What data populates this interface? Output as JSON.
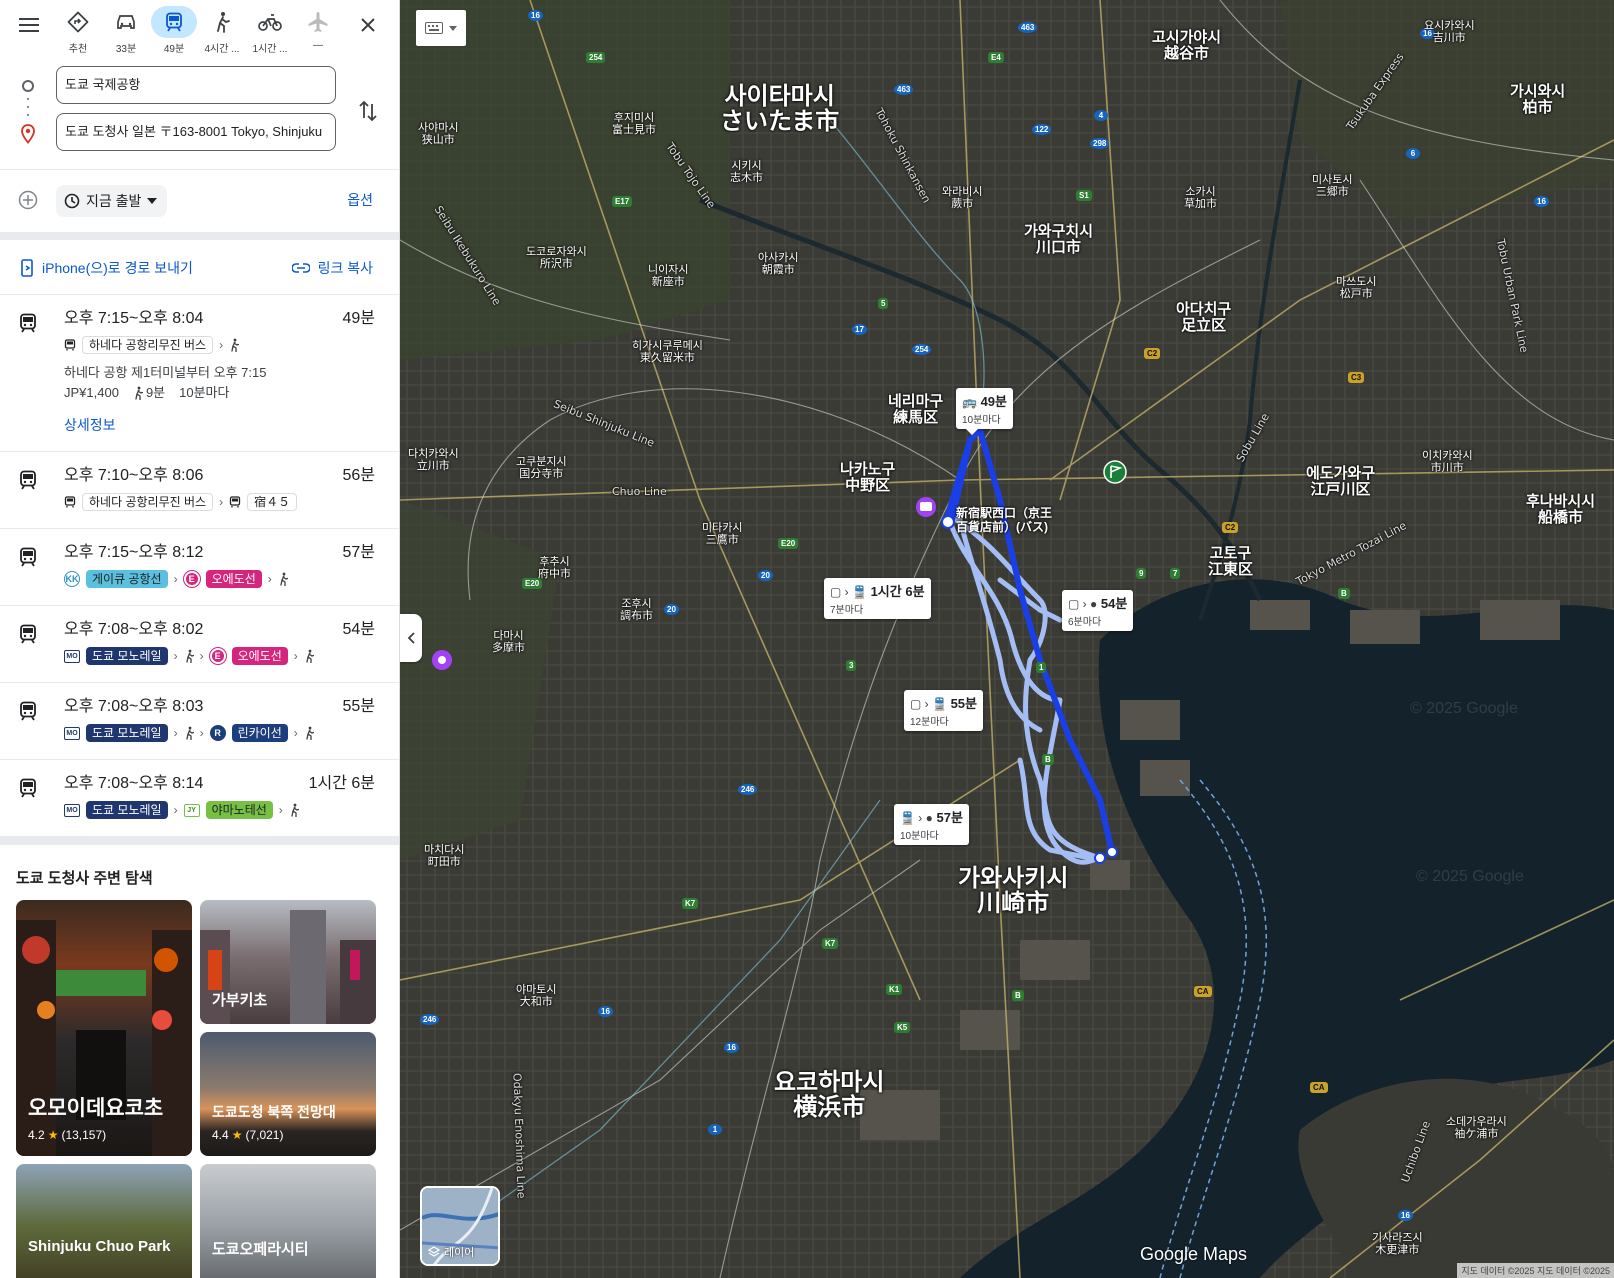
{
  "modes": [
    {
      "label": "추천",
      "icon": "directions-icon",
      "active": false
    },
    {
      "label": "33분",
      "icon": "car-icon",
      "active": false
    },
    {
      "label": "49분",
      "icon": "transit-icon",
      "active": true
    },
    {
      "label": "4시간 ...",
      "icon": "walk-icon",
      "active": false
    },
    {
      "label": "1시간 ...",
      "icon": "bike-icon",
      "active": false
    },
    {
      "label": "—",
      "icon": "flight-icon",
      "active": false
    }
  ],
  "inputs": {
    "origin": "도쿄 국제공항",
    "destination": "도쿄 도청사 일본 〒163-8001 Tokyo, Shinjuku"
  },
  "depart": {
    "label": "지금 출발",
    "options_label": "옵션"
  },
  "share": {
    "send_label": "iPhone(으)로 경로 보내기",
    "copy_label": "링크 복사"
  },
  "routes": [
    {
      "time": "오후 7:15~오후 8:04",
      "duration": "49분",
      "steps": [
        {
          "type": "bus-chip",
          "text": "하네다 공항리무진 버스"
        },
        {
          "type": "walk"
        }
      ],
      "sub1": "하네다 공항 제1터미널부터 오후 7:15",
      "fare": "JP¥1,400",
      "walk": "9분",
      "freq": "10분마다",
      "details": "상세정보"
    },
    {
      "time": "오후 7:10~오후 8:06",
      "duration": "56분",
      "steps": [
        {
          "type": "bus-chip",
          "text": "하네다 공항리무진 버스"
        },
        {
          "type": "bus-chip2",
          "text": "宿４５"
        }
      ]
    },
    {
      "time": "오후 7:15~오후 8:12",
      "duration": "57분",
      "steps": [
        {
          "type": "kk",
          "circle": "KK",
          "text": "게이큐 공항선"
        },
        {
          "type": "e",
          "circle": "E",
          "text": "오에도선"
        },
        {
          "type": "walk"
        }
      ]
    },
    {
      "time": "오후 7:08~오후 8:02",
      "duration": "54분",
      "steps": [
        {
          "type": "mono",
          "square": "MO",
          "text": "도쿄 모노레일"
        },
        {
          "type": "walk"
        },
        {
          "type": "e",
          "circle": "E",
          "text": "오에도선"
        },
        {
          "type": "walk"
        }
      ]
    },
    {
      "time": "오후 7:08~오후 8:03",
      "duration": "55분",
      "steps": [
        {
          "type": "mono",
          "square": "MO",
          "text": "도쿄 모노레일"
        },
        {
          "type": "walk"
        },
        {
          "type": "r",
          "circle": "R",
          "text": "린카이선"
        },
        {
          "type": "walk"
        }
      ]
    },
    {
      "time": "오후 7:08~오후 8:14",
      "duration": "1시간 6분",
      "steps": [
        {
          "type": "mono",
          "square": "MO",
          "text": "도쿄 모노레일"
        },
        {
          "type": "jy",
          "square": "JY",
          "text": "야마노테선"
        },
        {
          "type": "walk"
        }
      ]
    }
  ],
  "explore": {
    "title": "도쿄 도청사 주변 탐색",
    "cards": [
      {
        "title": "오모이데요코초",
        "rating": "4.2",
        "reviews": "(13,157)"
      },
      {
        "title": "가부키초"
      },
      {
        "title": "도쿄도청 북쪽 전망대",
        "rating": "4.4",
        "reviews": "(7,021)"
      },
      {
        "title": "Shinjuku Chuo Park"
      },
      {
        "title": "도쿄오페라시티"
      }
    ]
  },
  "map": {
    "big_cities": [
      {
        "ko": "사이타마시",
        "ja": "さいたま市"
      },
      {
        "ko": "가와사키시",
        "ja": "川崎市"
      },
      {
        "ko": "요코하마시",
        "ja": "横浜市"
      }
    ],
    "med_cities": [
      {
        "ko": "고시가야시",
        "ja": "越谷市"
      },
      {
        "ko": "가와구치시",
        "ja": "川口市"
      },
      {
        "ko": "아다치구",
        "ja": "足立区"
      },
      {
        "ko": "네리마구",
        "ja": "練馬区"
      },
      {
        "ko": "나카노구",
        "ja": "中野区"
      },
      {
        "ko": "에도가와구",
        "ja": "江戸川区"
      },
      {
        "ko": "고토구",
        "ja": "江東区"
      },
      {
        "ko": "가시와시",
        "ja": "柏市"
      },
      {
        "ko": "후나바시시",
        "ja": "船橋市"
      }
    ],
    "small_cities": [
      {
        "ko": "요시카와시",
        "ja": "吉川市"
      },
      {
        "ko": "사야마시",
        "ja": "狭山市"
      },
      {
        "ko": "후지미시",
        "ja": "富士見市"
      },
      {
        "ko": "시키시",
        "ja": "志木市"
      },
      {
        "ko": "와라비시",
        "ja": "蕨市"
      },
      {
        "ko": "소카시",
        "ja": "草加市"
      },
      {
        "ko": "미사토시",
        "ja": "三郷市"
      },
      {
        "ko": "도코로자와시",
        "ja": "所沢市"
      },
      {
        "ko": "니이자시",
        "ja": "新座市"
      },
      {
        "ko": "아사카시",
        "ja": "朝霞市"
      },
      {
        "ko": "마쓰도시",
        "ja": "松戸市"
      },
      {
        "ko": "히가시쿠루메시",
        "ja": "東久留米市"
      },
      {
        "ko": "다치카와시",
        "ja": "立川市"
      },
      {
        "ko": "고쿠분지시",
        "ja": "国分寺市"
      },
      {
        "ko": "미타카시",
        "ja": "三鷹市"
      },
      {
        "ko": "후추시",
        "ja": "府中市"
      },
      {
        "ko": "조후시",
        "ja": "調布市"
      },
      {
        "ko": "다마시",
        "ja": "多摩市"
      },
      {
        "ko": "이치카와시",
        "ja": "市川市"
      },
      {
        "ko": "마치다시",
        "ja": "町田市"
      },
      {
        "ko": "야마토시",
        "ja": "大和市"
      },
      {
        "ko": "소데가우라시",
        "ja": "袖ケ浦市"
      },
      {
        "ko": "기사라즈시",
        "ja": "木更津市"
      }
    ],
    "route_labels": [
      {
        "text": "49분",
        "freq": "10분마다"
      },
      {
        "text": "1시간 6분",
        "freq": "7분마다"
      },
      {
        "text": "54분",
        "freq": "6분마다"
      },
      {
        "text": "55분",
        "freq": "12분마다"
      },
      {
        "text": "57분",
        "freq": "10분마다"
      }
    ],
    "station": "新宿駅西口（京王\n百貨店前）(バス)",
    "rail_labels": [
      "Tobu Tojo Line",
      "Seibu Ikebukuro Line",
      "Seibu Shinjuku Line",
      "Chuo Line",
      "Tobu Urban Park Line",
      "Tokyo Metro Tozai Line",
      "Odakyu Enoshima Line",
      "Tohoku Shinkansen",
      "Tsukuba Express",
      "Uchibo Line",
      "Sobu Line"
    ],
    "layers_label": "레이어",
    "logo": "Google Maps",
    "attribution": "지도 데이터 ©2025 지도 데이터 ©2025",
    "watermark": "© 2025 Google"
  },
  "colors": {
    "accent_blue": "#0b57d0",
    "active_mode_bg": "#c2e7ff",
    "route_primary": "#1a3fe6",
    "route_alt": "#9fb8f5"
  }
}
